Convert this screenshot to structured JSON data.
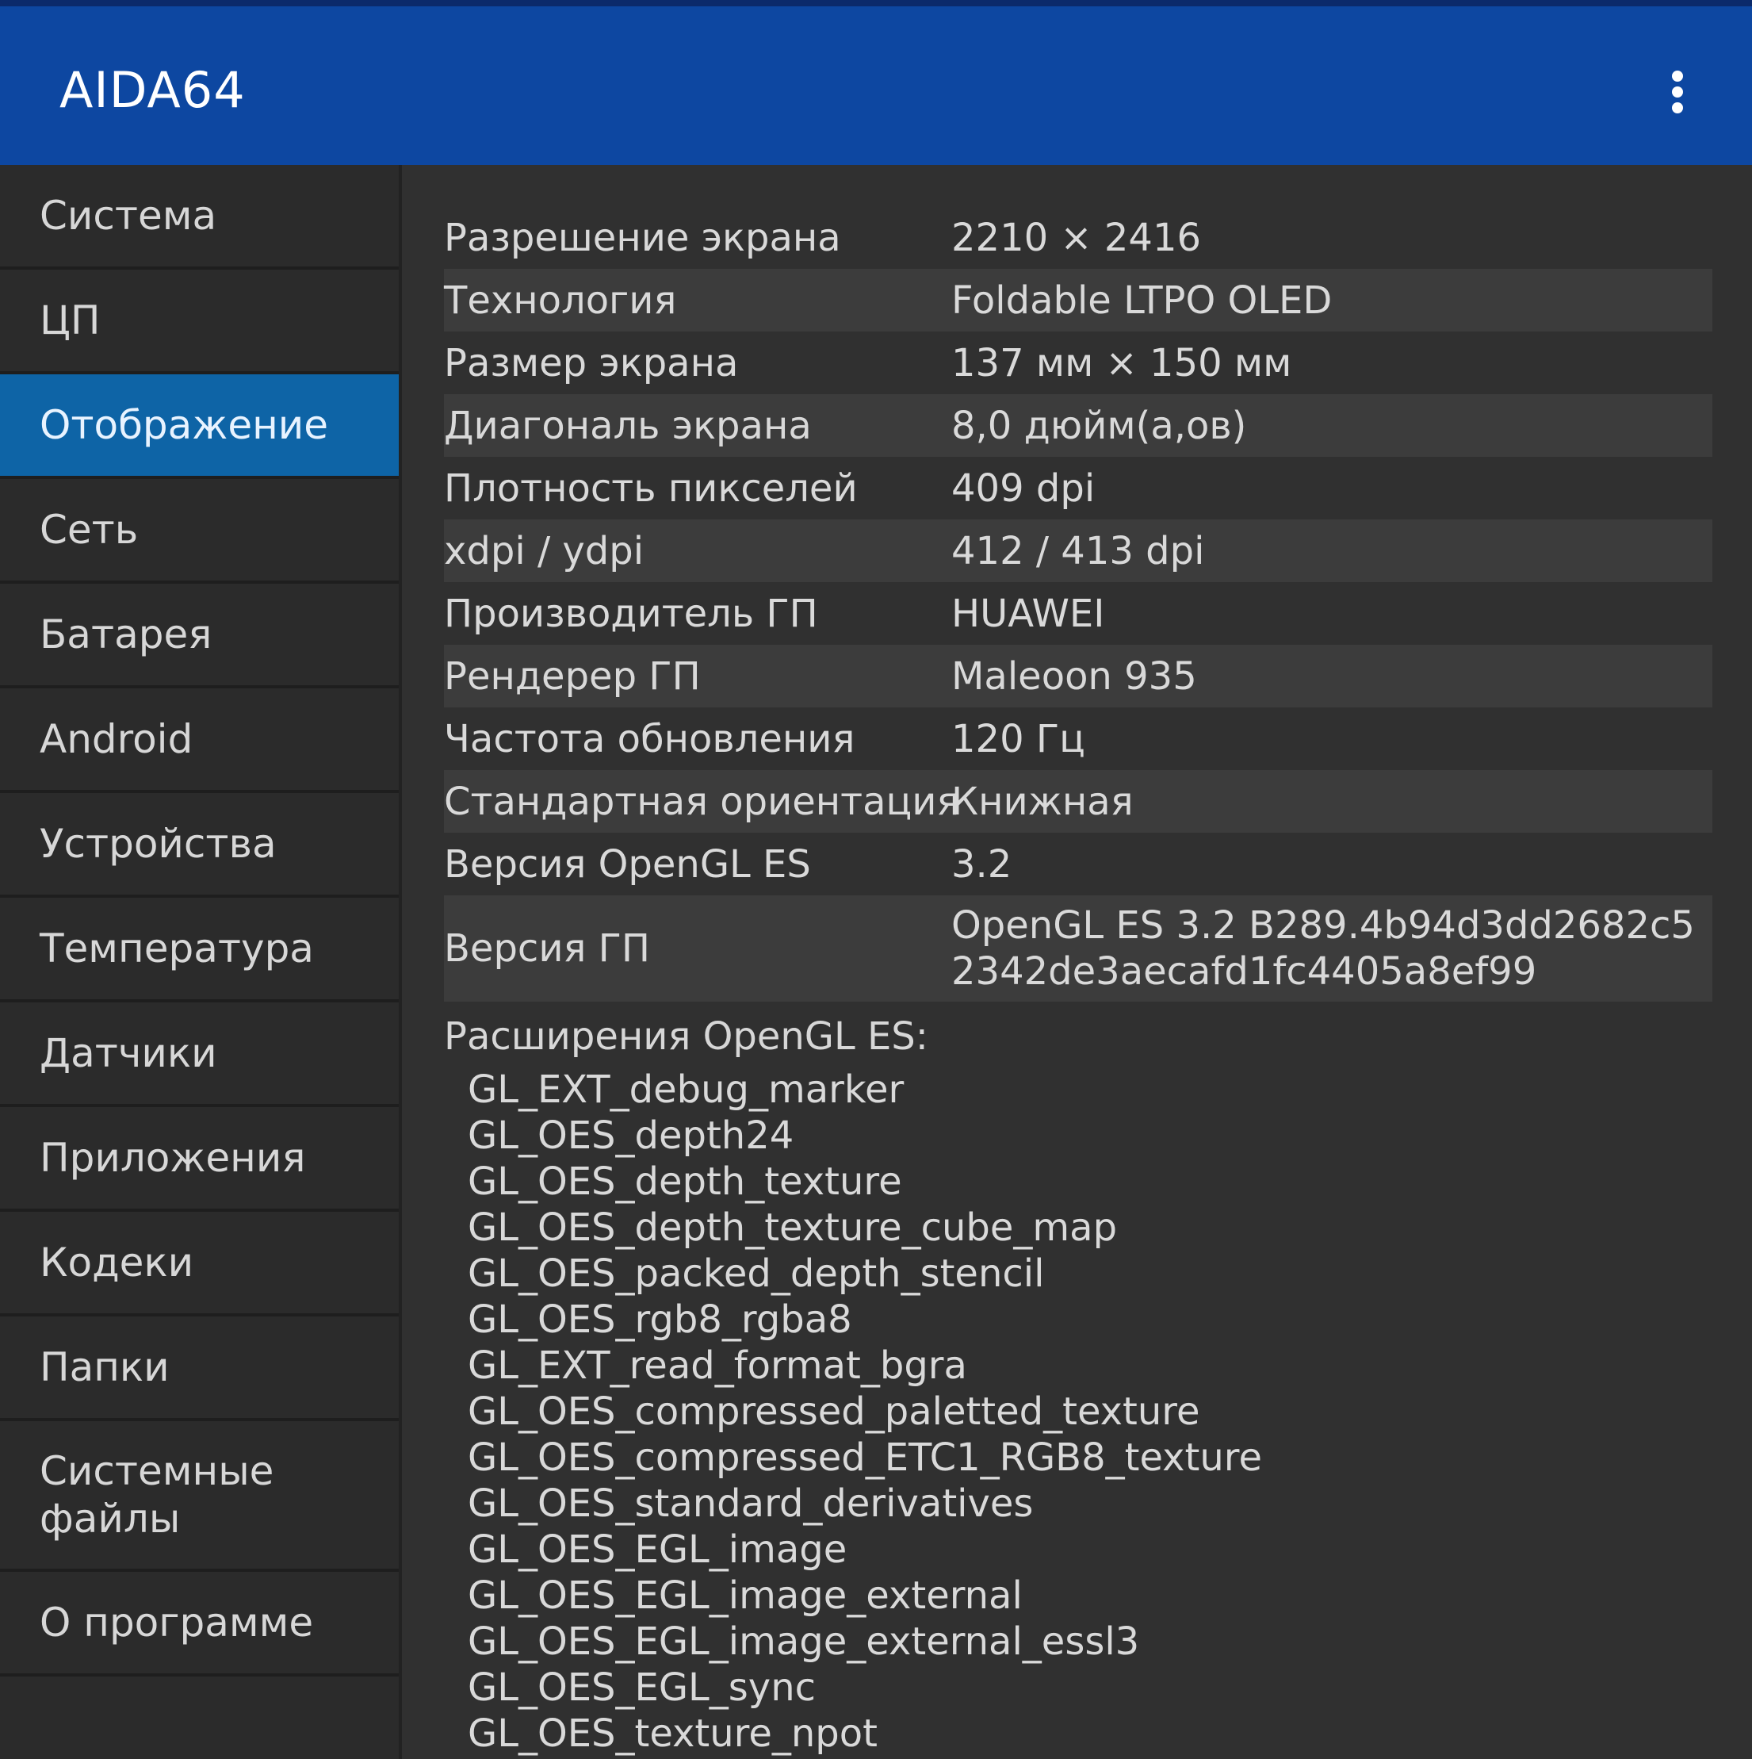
{
  "app": {
    "title": "AIDA64",
    "menu_icon": "more-vert-icon"
  },
  "colors": {
    "topbar": "#0d47a1",
    "active_item": "#0e64a6",
    "background": "#303030"
  },
  "sidebar": {
    "items": [
      {
        "label": "Система",
        "active": false
      },
      {
        "label": "ЦП",
        "active": false
      },
      {
        "label": "Отображение",
        "active": true
      },
      {
        "label": "Сеть",
        "active": false
      },
      {
        "label": "Батарея",
        "active": false
      },
      {
        "label": "Android",
        "active": false
      },
      {
        "label": "Устройства",
        "active": false
      },
      {
        "label": "Температура",
        "active": false
      },
      {
        "label": "Датчики",
        "active": false
      },
      {
        "label": "Приложения",
        "active": false
      },
      {
        "label": "Кодеки",
        "active": false
      },
      {
        "label": "Папки",
        "active": false
      },
      {
        "label": "Системные файлы",
        "active": false
      },
      {
        "label": "О программе",
        "active": false
      }
    ]
  },
  "details": {
    "rows": [
      {
        "label": "Разрешение экрана",
        "value": "2210 × 2416"
      },
      {
        "label": "Технология",
        "value": "Foldable LTPO OLED"
      },
      {
        "label": "Размер экрана",
        "value": "137 мм × 150 мм"
      },
      {
        "label": "Диагональ экрана",
        "value": "8,0 дюйм(а,ов)"
      },
      {
        "label": "Плотность пикселей",
        "value": "409 dpi"
      },
      {
        "label": "xdpi / ydpi",
        "value": "412 / 413 dpi"
      },
      {
        "label": "Производитель ГП",
        "value": "HUAWEI"
      },
      {
        "label": "Рендерер ГП",
        "value": "Maleoon 935"
      },
      {
        "label": "Частота обновления",
        "value": "120 Гц"
      },
      {
        "label": "Стандартная ориентация",
        "value": "Книжная"
      },
      {
        "label": "Версия OpenGL ES",
        "value": "3.2"
      },
      {
        "label": "Версия ГП",
        "value": "OpenGL ES 3.2 B289.4b94d3dd2682c52342de3aecafd1fc4405a8ef99"
      }
    ],
    "extensions_title": "Расширения OpenGL ES:",
    "extensions": [
      "GL_EXT_debug_marker",
      "GL_OES_depth24",
      "GL_OES_depth_texture",
      "GL_OES_depth_texture_cube_map",
      "GL_OES_packed_depth_stencil",
      "GL_OES_rgb8_rgba8",
      "GL_EXT_read_format_bgra",
      "GL_OES_compressed_paletted_texture",
      "GL_OES_compressed_ETC1_RGB8_texture",
      "GL_OES_standard_derivatives",
      "GL_OES_EGL_image",
      "GL_OES_EGL_image_external",
      "GL_OES_EGL_image_external_essl3",
      "GL_OES_EGL_sync",
      "GL_OES_texture_npot"
    ]
  }
}
